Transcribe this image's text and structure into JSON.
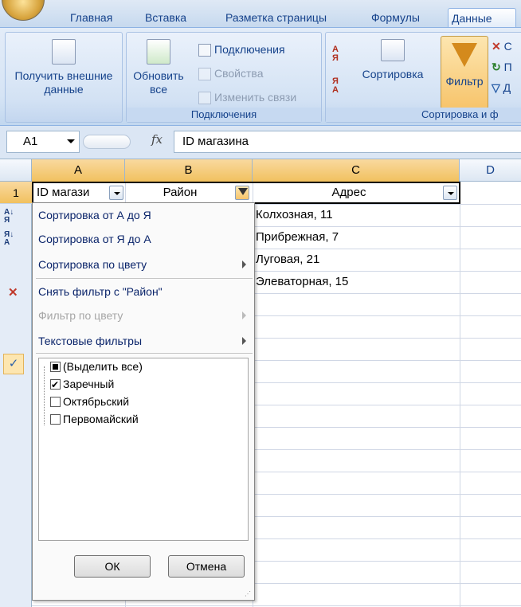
{
  "ribbon": {
    "tabs": [
      "Главная",
      "Вставка",
      "Разметка страницы",
      "Формулы",
      "Данные"
    ],
    "get_external_data": "Получить внешние данные",
    "refresh_all": "Обновить все",
    "connections": "Подключения",
    "properties": "Свойства",
    "edit_links": "Изменить связи",
    "connections_group": "Подключения",
    "sort": "Сортировка",
    "filter": "Фильтр",
    "sort_filter_group": "Сортировка и ф",
    "clear_initial": "С",
    "reapply_initial": "П",
    "advanced_initial": "Д"
  },
  "formula_bar": {
    "cell_ref": "A1",
    "fx": "fx",
    "value": "ID магазина"
  },
  "sheet": {
    "columns": [
      "A",
      "B",
      "C",
      "D"
    ],
    "rows": [
      "1"
    ],
    "header_row": [
      "ID магази",
      "Район",
      "Адрес"
    ],
    "column_c": [
      "Колхозная, 11",
      "Прибрежная, 7",
      "Луговая, 21",
      "Элеваторная, 15"
    ]
  },
  "menu": {
    "sort_asc": "Сортировка от А до Я",
    "sort_desc": "Сортировка от Я до А",
    "sort_by_color": "Сортировка по цвету",
    "clear_filter": "Снять фильтр с \"Район\"",
    "filter_by_color": "Фильтр по цвету",
    "text_filters": "Текстовые фильтры",
    "checklist": [
      {
        "label": "(Выделить все)",
        "state": "mixed"
      },
      {
        "label": "Заречный",
        "state": "checked"
      },
      {
        "label": "Октябрьский",
        "state": "unchecked"
      },
      {
        "label": "Первомайский",
        "state": "unchecked"
      }
    ],
    "ok": "ОК",
    "cancel": "Отмена"
  },
  "colors": {
    "ribbon_blue": "#15428b",
    "selected_header": "#f1c15f",
    "filter_active": "#f7c46b"
  }
}
